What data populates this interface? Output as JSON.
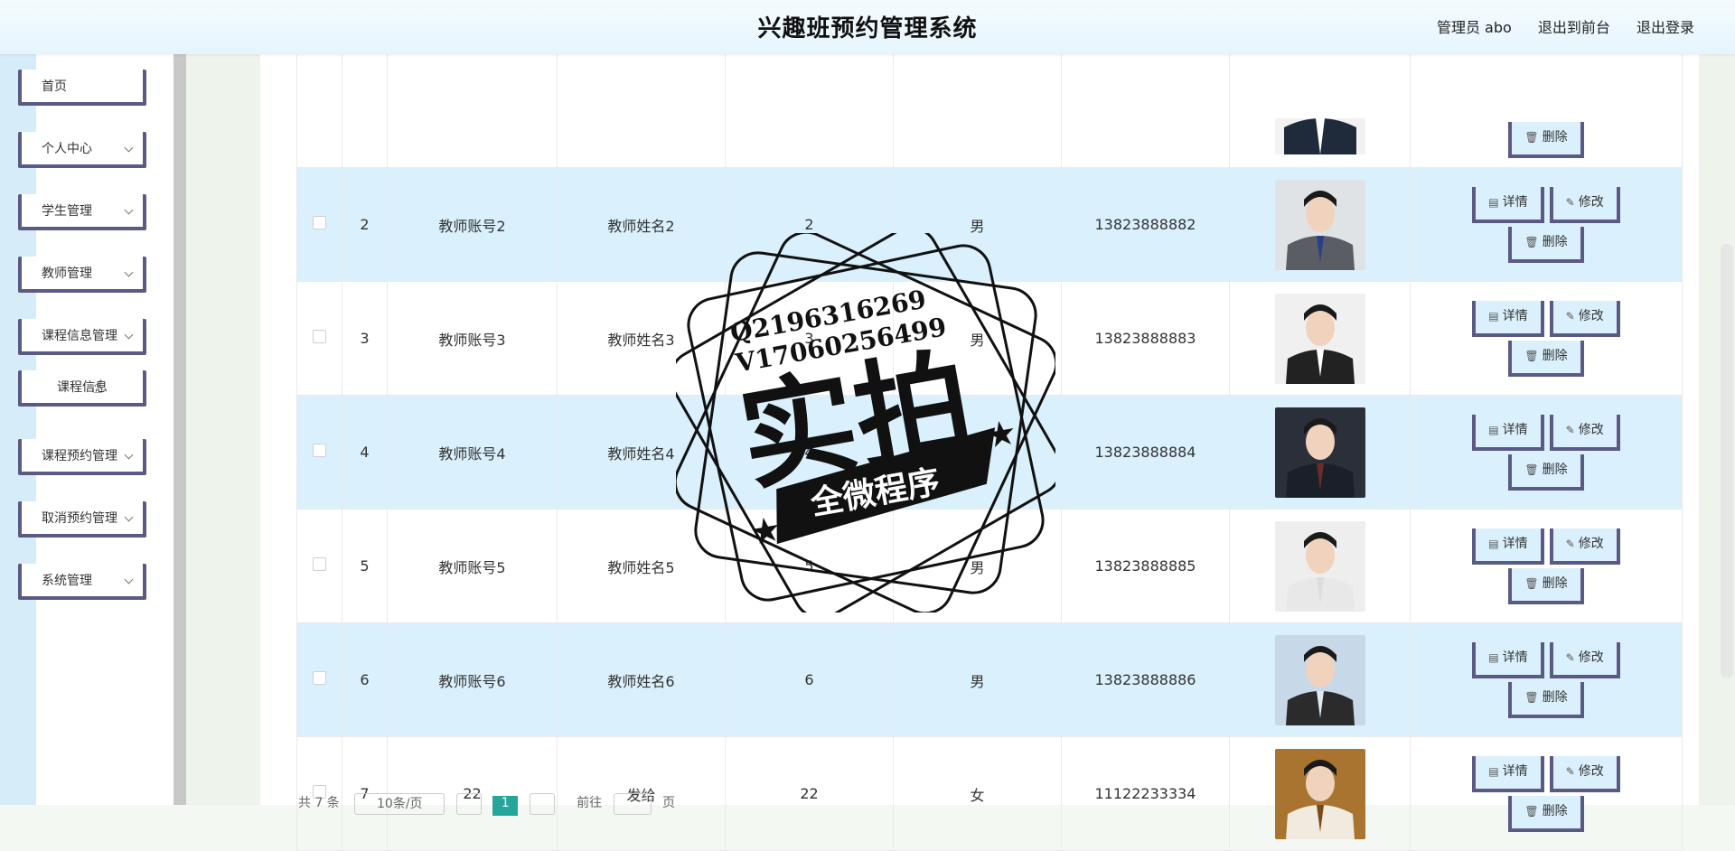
{
  "header": {
    "title": "兴趣班预约管理系统",
    "user": "管理员 abo",
    "to_front": "退出到前台",
    "logout": "退出登录"
  },
  "sidebar": {
    "items": [
      {
        "label": "首页"
      },
      {
        "label": "个人中心"
      },
      {
        "label": "学生管理"
      },
      {
        "label": "教师管理"
      },
      {
        "label": "课程信息管理"
      },
      {
        "label": "课程信息"
      },
      {
        "label": "课程预约管理"
      },
      {
        "label": "取消预约管理"
      },
      {
        "label": "系统管理"
      }
    ]
  },
  "table": {
    "buttons": {
      "detail": "详情",
      "edit": "修改",
      "delete": "删除"
    },
    "rows": [
      {
        "index": "2",
        "account": "教师账号2",
        "name": "教师姓名2",
        "age": "2",
        "gender": "男",
        "phone": "13823888882"
      },
      {
        "index": "3",
        "account": "教师账号3",
        "name": "教师姓名3",
        "age": "3",
        "gender": "男",
        "phone": "13823888883"
      },
      {
        "index": "4",
        "account": "教师账号4",
        "name": "教师姓名4",
        "age": "4",
        "gender": "男",
        "phone": "13823888884"
      },
      {
        "index": "5",
        "account": "教师账号5",
        "name": "教师姓名5",
        "age": "5",
        "gender": "男",
        "phone": "13823888885"
      },
      {
        "index": "6",
        "account": "教师账号6",
        "name": "教师姓名6",
        "age": "6",
        "gender": "男",
        "phone": "13823888886"
      },
      {
        "index": "7",
        "account": "22",
        "name": "发给",
        "age": "22",
        "gender": "女",
        "phone": "11122233334"
      }
    ]
  },
  "pagination": {
    "total": "共 7 条",
    "page_size": "10条/页",
    "current_page": "1",
    "goto": "前往",
    "page_unit": "页"
  },
  "watermark": {
    "line1": "Q2196316269",
    "line2": "V17060256499",
    "big": "实拍",
    "banner": "全微程序"
  },
  "colors": {
    "header_bg": "#e6f5fd",
    "row_alt": "#daf0fc",
    "btn_border": "#5b5a85",
    "pager_active": "#26a69a"
  }
}
